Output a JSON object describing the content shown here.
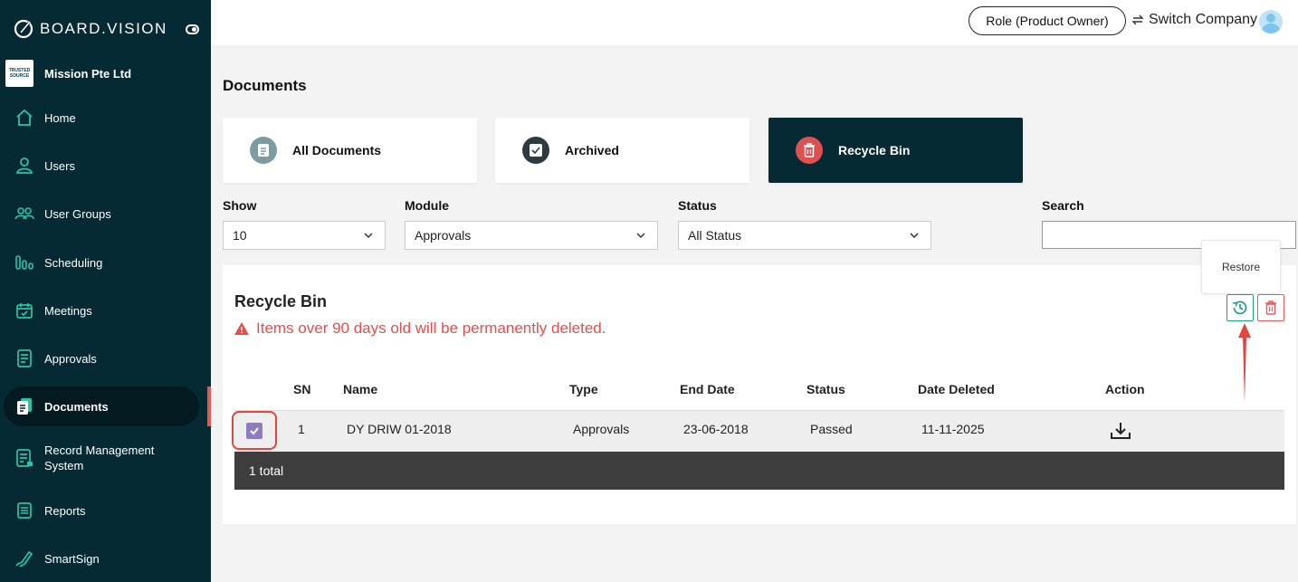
{
  "brand": {
    "name": "BOARD.VISION"
  },
  "org": {
    "name": "Mission Pte Ltd",
    "logo_line1": "TRUSTED",
    "logo_line2": "SOURCE"
  },
  "sidebar": {
    "items": [
      {
        "label": "Home",
        "icon": "home-icon"
      },
      {
        "label": "Users",
        "icon": "user-icon"
      },
      {
        "label": "User Groups",
        "icon": "users-icon"
      },
      {
        "label": "Scheduling",
        "icon": "scheduling-icon"
      },
      {
        "label": "Meetings",
        "icon": "calendar-icon"
      },
      {
        "label": "Approvals",
        "icon": "approvals-icon"
      },
      {
        "label": "Documents",
        "icon": "documents-icon",
        "active": true
      },
      {
        "label": "Record Management System",
        "icon": "records-icon"
      },
      {
        "label": "Reports",
        "icon": "reports-icon"
      },
      {
        "label": "SmartSign",
        "icon": "signature-icon"
      }
    ]
  },
  "topbar": {
    "role_label": "Role (Product Owner)",
    "switch_label": "Switch Company"
  },
  "page": {
    "title": "Documents"
  },
  "tabs": [
    {
      "label": "All Documents",
      "icon": "document-icon",
      "color": "#7d9ca2"
    },
    {
      "label": "Archived",
      "icon": "archive-check-icon",
      "color": "#2d3a40"
    },
    {
      "label": "Recycle Bin",
      "icon": "trash-icon",
      "color": "#e05050",
      "active": true
    }
  ],
  "filters": {
    "show_label": "Show",
    "show_value": "10",
    "module_label": "Module",
    "module_value": "Approvals",
    "status_label": "Status",
    "status_value": "All Status",
    "search_label": "Search",
    "search_value": ""
  },
  "panel": {
    "title": "Recycle Bin",
    "warning": "Items over 90 days old will be permanently deleted.",
    "restore_tooltip": "Restore"
  },
  "table": {
    "headers": [
      "SN",
      "Name",
      "Type",
      "End Date",
      "Status",
      "Date Deleted",
      "Action"
    ],
    "rows": [
      {
        "sn": "1",
        "name": "DY DRIW 01-2018",
        "type": "Approvals",
        "end_date": "23-06-2018",
        "status": "Passed",
        "date_deleted": "11-11-2025",
        "checked": true
      }
    ],
    "footer": "1 total"
  },
  "colors": {
    "sidebar": "#062a33",
    "accent_teal": "#1f9c8c",
    "danger": "#e05050",
    "checkbox": "#8e7cc3"
  }
}
